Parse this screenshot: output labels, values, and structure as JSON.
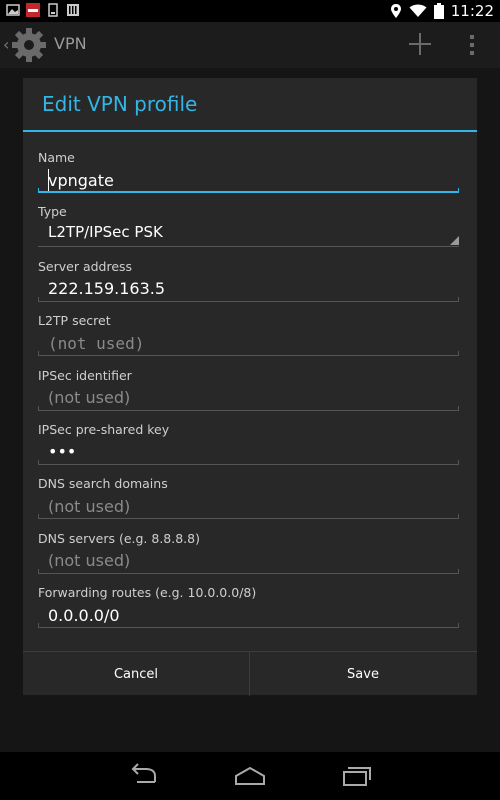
{
  "status_bar": {
    "time": "11:22",
    "notification_icons": [
      "gallery-icon",
      "news-app-icon",
      "download-icon",
      "store-icon"
    ],
    "system_icons": [
      "location-icon",
      "wifi-icon",
      "battery-icon"
    ]
  },
  "action_bar": {
    "title": "VPN",
    "icons": [
      "back-chevron-icon",
      "settings-gear-icon",
      "add-icon",
      "overflow-menu-icon"
    ]
  },
  "dialog": {
    "title": "Edit VPN profile",
    "fields": {
      "name": {
        "label": "Name",
        "value": "vpngate"
      },
      "type": {
        "label": "Type",
        "value": "L2TP/IPSec PSK"
      },
      "server": {
        "label": "Server address",
        "value": "222.159.163.5"
      },
      "l2tp_secret": {
        "label": "L2TP secret",
        "placeholder": "(not used)"
      },
      "ipsec_identifier": {
        "label": "IPSec identifier",
        "placeholder": "(not used)"
      },
      "ipsec_psk": {
        "label": "IPSec pre-shared key",
        "value": "•••"
      },
      "dns_search": {
        "label": "DNS search domains",
        "placeholder": "(not used)"
      },
      "dns_servers": {
        "label": "DNS servers (e.g. 8.8.8.8)",
        "placeholder": "(not used)"
      },
      "routes": {
        "label": "Forwarding routes (e.g. 10.0.0.0/8)",
        "value": "0.0.0.0/0"
      }
    },
    "buttons": {
      "cancel": "Cancel",
      "save": "Save"
    }
  },
  "nav_bar": {
    "icons": [
      "back-icon",
      "home-icon",
      "recents-icon"
    ]
  },
  "colors": {
    "accent": "#33b5e5",
    "dialog_bg": "#282828",
    "hint": "#8a8a8a"
  }
}
